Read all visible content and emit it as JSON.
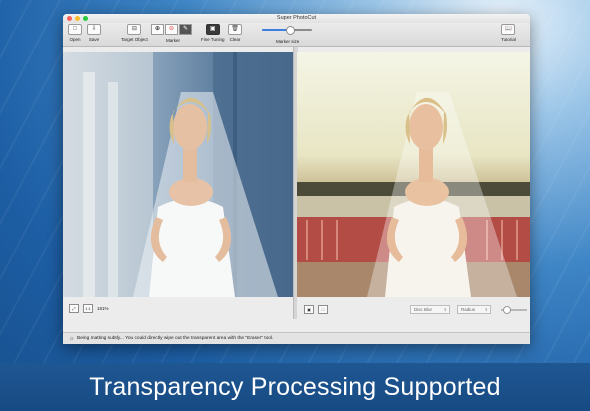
{
  "window": {
    "title": "Super PhotoCut"
  },
  "toolbar": {
    "open_label": "Open",
    "save_label": "Save",
    "target_object_label": "Target Object",
    "marker_label": "Marker",
    "fine_tuning_label": "Fine Tuning",
    "clear_label": "Clear",
    "marker_size_label": "Marker size",
    "tutorial_label": "Tutorial",
    "marker_size_value": 0.55
  },
  "left_pane": {
    "zoom_level": "181%"
  },
  "right_pane": {
    "disc_blur_option": "Disc Blur",
    "radius_option": "Radius"
  },
  "status": {
    "message": "Being matting subtly... You could directly wipe out the transparent area with the \"Eraser\" tool."
  },
  "banner": {
    "text": "Transparency Processing Supported"
  },
  "colors": {
    "accent": "#3d7fe0",
    "banner_bg": "#1c5490",
    "background_blue": "#2a6fb5"
  }
}
